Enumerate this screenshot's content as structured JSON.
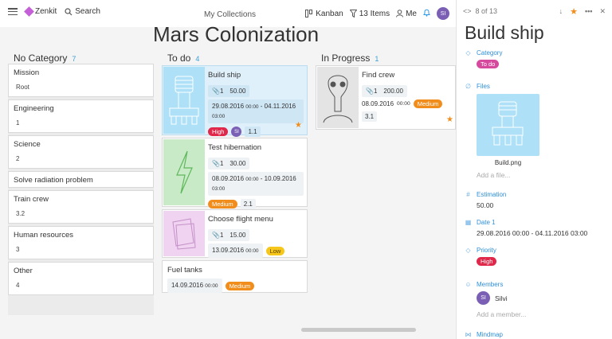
{
  "topbar": {
    "app_name": "Zenkit",
    "search_label": "Search",
    "collections_label": "My Collections",
    "view_label": "Kanban",
    "filter_label": "13 Items",
    "me_label": "Me",
    "avatar_initials": "SI"
  },
  "page": {
    "title": "Mars Colonization"
  },
  "columns": {
    "no_category": {
      "title": "No Category",
      "count": "7",
      "cards": [
        {
          "title": "Mission",
          "value": "Root"
        },
        {
          "title": "Engineering",
          "value": "1"
        },
        {
          "title": "Science",
          "value": "2"
        },
        {
          "title": "Solve radiation problem",
          "value": ""
        },
        {
          "title": "Train crew",
          "value": "3.2"
        },
        {
          "title": "Human resources",
          "value": "3"
        },
        {
          "title": "Other",
          "value": "4"
        }
      ]
    },
    "todo": {
      "title": "To do",
      "count": "4",
      "cards": [
        {
          "title": "Build ship",
          "attachments": "1",
          "estimation": "50.00",
          "date_start": "29.08.2016",
          "time_start": "00:00",
          "date_end": "04.11.2016",
          "time_end": "03:00",
          "priority": "High",
          "member": "SI",
          "number": "1.1"
        },
        {
          "title": "Test hibernation",
          "attachments": "1",
          "estimation": "30.00",
          "date_start": "08.09.2016",
          "time_start": "00:00",
          "date_end": "10.09.2016",
          "time_end": "03:00",
          "priority": "Medium",
          "number": "2.1"
        },
        {
          "title": "Choose flight menu",
          "attachments": "1",
          "estimation": "15.00",
          "date_start": "13.09.2016",
          "time_start": "00:00",
          "priority": "Low"
        },
        {
          "title": "Fuel tanks",
          "date_start": "14.09.2016",
          "time_start": "00:00",
          "priority": "Medium"
        }
      ]
    },
    "in_progress": {
      "title": "In Progress",
      "count": "1",
      "cards": [
        {
          "title": "Find crew",
          "attachments": "1",
          "estimation": "200.00",
          "date_start": "08.09.2016",
          "time_start": "00:00",
          "priority": "Medium",
          "number": "3.1"
        }
      ]
    }
  },
  "panel": {
    "position": "8 of 13",
    "title": "Build ship",
    "category_label": "Category",
    "category_value": "To do",
    "files_label": "Files",
    "file_name": "Build.png",
    "add_file": "Add a file...",
    "estimation_label": "Estimation",
    "estimation_value": "50.00",
    "date_label": "Date 1",
    "date_value": "29.08.2016 00:00 - 04.11.2016 03:00",
    "priority_label": "Priority",
    "priority_value": "High",
    "members_label": "Members",
    "member_initials": "SI",
    "member_name": "Silvi",
    "add_member": "Add a member...",
    "mindmap_label": "Mindmap"
  },
  "colors": {
    "accent": "#2e8fd8",
    "high": "#e0284b",
    "medium": "#f08d1c",
    "low": "#f6c71a",
    "todo": "#d64a9e"
  }
}
